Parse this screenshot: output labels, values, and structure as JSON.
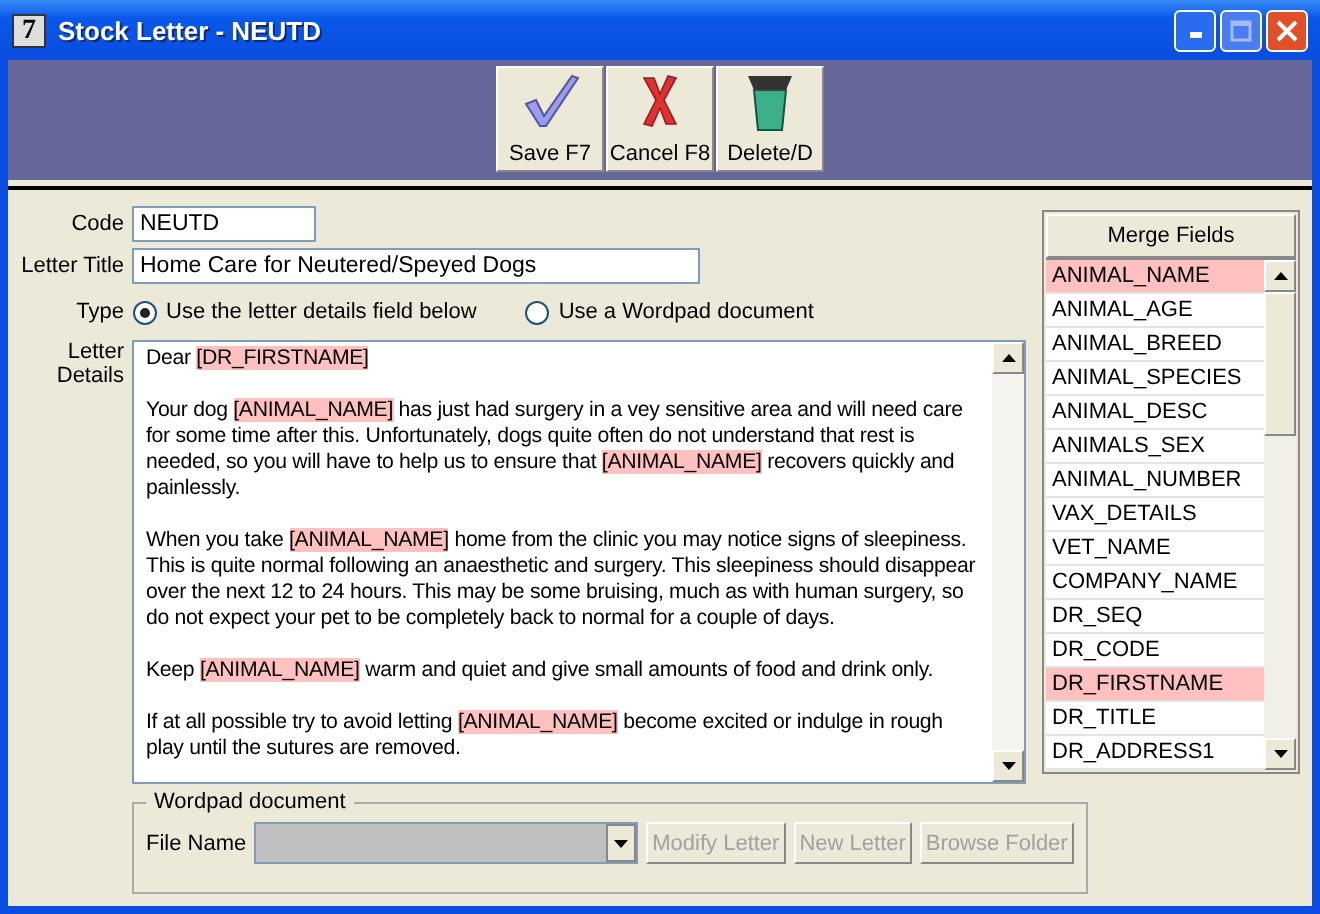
{
  "window": {
    "icon_text": "7",
    "title": "Stock Letter - NEUTD"
  },
  "toolbar": [
    {
      "label": "Save F7",
      "kind": "save"
    },
    {
      "label": "Cancel F8",
      "kind": "cancel"
    },
    {
      "label": "Delete/D",
      "kind": "delete"
    }
  ],
  "form": {
    "code_label": "Code",
    "code": "NEUTD",
    "title_label": "Letter Title",
    "title": "Home Care for Neutered/Speyed Dogs",
    "type_label": "Type",
    "type_options": [
      {
        "label": "Use the letter details field below",
        "selected": true
      },
      {
        "label": "Use a Wordpad document",
        "selected": false
      }
    ],
    "details_label": "Letter Details",
    "details": [
      [
        {
          "text": "Dear ",
          "field": false
        },
        {
          "text": "[DR_FIRSTNAME]",
          "field": true
        }
      ],
      [
        {
          "text": "Your dog ",
          "field": false
        },
        {
          "text": "[ANIMAL_NAME]",
          "field": true
        },
        {
          "text": " has just had surgery in a vey sensitive area and will need care for some time after this.  Unfortunately, dogs quite often do not understand that rest is needed, so you will have to help us to ensure that ",
          "field": false
        },
        {
          "text": "[ANIMAL_NAME]",
          "field": true
        },
        {
          "text": " recovers quickly and painlessly.",
          "field": false
        }
      ],
      [
        {
          "text": "When you take ",
          "field": false
        },
        {
          "text": "[ANIMAL_NAME]",
          "field": true
        },
        {
          "text": " home from the clinic you may notice signs of sleepiness.  This is quite normal following an anaesthetic and surgery.  This sleepiness should disappear over the next 12 to 24 hours.  This may be some bruising, much as with human surgery, so do not expect your pet to be completely back to normal for a couple of days.",
          "field": false
        }
      ],
      [
        {
          "text": "Keep ",
          "field": false
        },
        {
          "text": "[ANIMAL_NAME]",
          "field": true
        },
        {
          "text": " warm and quiet and give small amounts of food and drink only.",
          "field": false
        }
      ],
      [
        {
          "text": "If at all possible try to avoid letting ",
          "field": false
        },
        {
          "text": "[ANIMAL_NAME]",
          "field": true
        },
        {
          "text": " become excited or indulge in rough play until the sutures are removed.",
          "field": false
        }
      ]
    ]
  },
  "wordpad": {
    "legend": "Wordpad document",
    "file_label": "File Name",
    "file_disabled": true,
    "buttons": [
      {
        "label": "Modify Letter",
        "disabled": true
      },
      {
        "label": "New Letter",
        "disabled": true
      },
      {
        "label": "Browse Folder",
        "disabled": true
      }
    ]
  },
  "merge_fields": {
    "header": "Merge Fields",
    "items": [
      {
        "name": "ANIMAL_NAME",
        "highlighted": true
      },
      {
        "name": "ANIMAL_AGE",
        "highlighted": false
      },
      {
        "name": "ANIMAL_BREED",
        "highlighted": false
      },
      {
        "name": "ANIMAL_SPECIES",
        "highlighted": false
      },
      {
        "name": "ANIMAL_DESC",
        "highlighted": false
      },
      {
        "name": "ANIMALS_SEX",
        "highlighted": false
      },
      {
        "name": "ANIMAL_NUMBER",
        "highlighted": false
      },
      {
        "name": "VAX_DETAILS",
        "highlighted": false
      },
      {
        "name": "VET_NAME",
        "highlighted": false
      },
      {
        "name": "COMPANY_NAME",
        "highlighted": false
      },
      {
        "name": "DR_SEQ",
        "highlighted": false
      },
      {
        "name": "DR_CODE",
        "highlighted": false
      },
      {
        "name": "DR_FIRSTNAME",
        "highlighted": true
      },
      {
        "name": "DR_TITLE",
        "highlighted": false
      },
      {
        "name": "DR_ADDRESS1",
        "highlighted": false
      }
    ]
  }
}
